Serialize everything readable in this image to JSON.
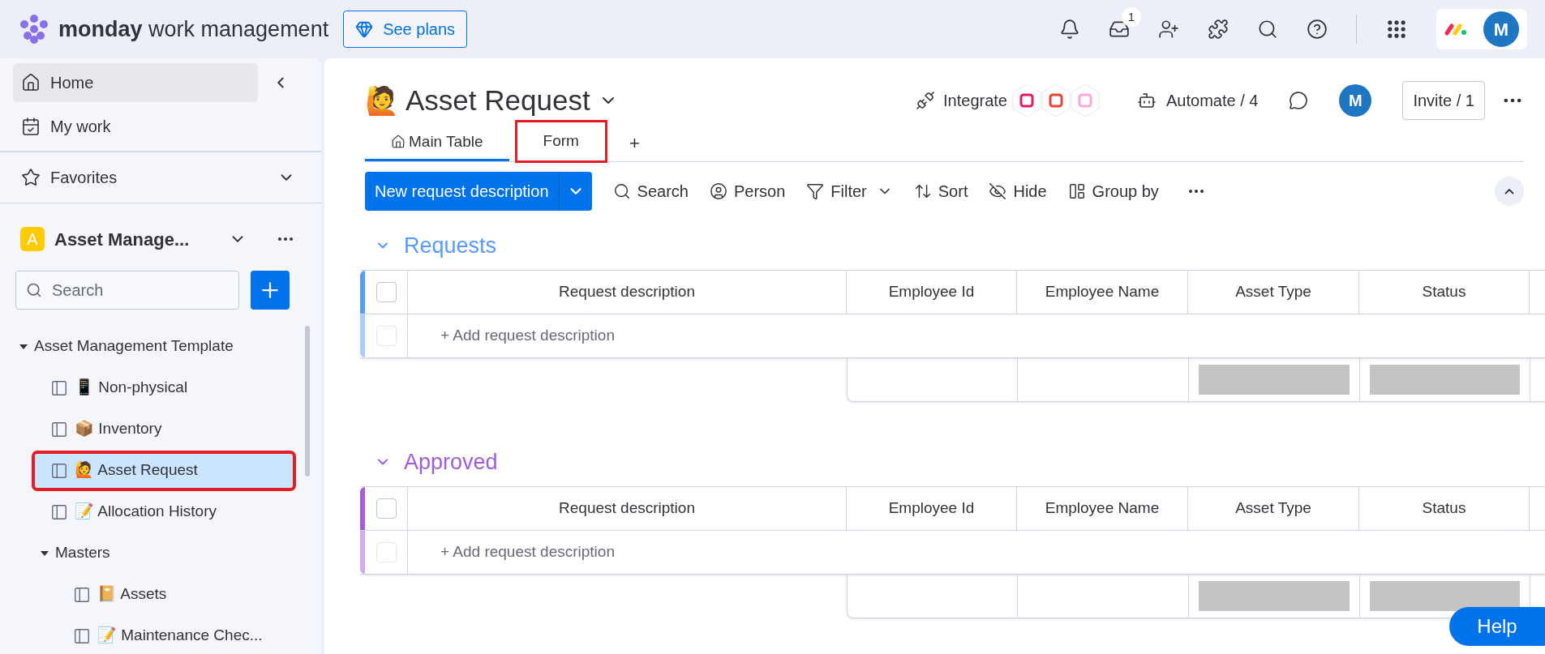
{
  "topbar": {
    "brand_bold": "monday",
    "brand_rest": "work management",
    "plans_button": "See plans",
    "inbox_badge": "1",
    "avatar": "M"
  },
  "sidebar": {
    "nav": [
      {
        "label": "Home",
        "selected": true
      },
      {
        "label": "My work",
        "selected": false
      }
    ],
    "favorites": "Favorites",
    "workspace": {
      "badge": "A",
      "name": "Asset Manage..."
    },
    "search": {
      "placeholder": "Search"
    },
    "tree": [
      {
        "label": "Asset Management Template",
        "expanded": true,
        "children": [
          {
            "label": "Non-physical",
            "emoji": "📱",
            "selected": false,
            "annotated": false
          },
          {
            "label": "Inventory",
            "emoji": "📦",
            "selected": false,
            "annotated": false
          },
          {
            "label": "Asset Request",
            "emoji": "🙋",
            "selected": true,
            "annotated": true
          },
          {
            "label": "Allocation History",
            "emoji": "📝",
            "selected": false,
            "annotated": false
          },
          {
            "label": "Masters",
            "expanded": true,
            "children": [
              {
                "label": "Assets",
                "emoji": "📔",
                "selected": false,
                "annotated": false
              },
              {
                "label": "Maintenance Chec...",
                "emoji": "📝",
                "selected": false,
                "annotated": false
              }
            ]
          }
        ]
      }
    ]
  },
  "board": {
    "emoji": "🙋",
    "title": "Asset Request",
    "integrate": "Integrate",
    "automate": "Automate / 4",
    "avatar": "M",
    "invite": "Invite / 1",
    "tabs": [
      {
        "label": "Main Table",
        "selected": true,
        "annotated": false
      },
      {
        "label": "Form",
        "selected": false,
        "annotated": true
      }
    ],
    "add_tab": "+",
    "new_button": "New request description",
    "toolbar": [
      "Search",
      "Person",
      "Filter",
      "Sort",
      "Hide",
      "Group by"
    ],
    "groups": [
      {
        "title": "Requests",
        "color": "#579bfc",
        "header_checked": false,
        "columns": [
          "Request description",
          "Employee Id",
          "Employee Name",
          "Asset Type",
          "Status"
        ],
        "row_checked": false,
        "add_row": "+ Add request description"
      },
      {
        "title": "Approved",
        "color": "#a25ddc",
        "header_checked": false,
        "columns": [
          "Request description",
          "Employee Id",
          "Employee Name",
          "Asset Type",
          "Status"
        ],
        "row_checked": false,
        "add_row": "+ Add request description"
      }
    ]
  },
  "help": "Help"
}
